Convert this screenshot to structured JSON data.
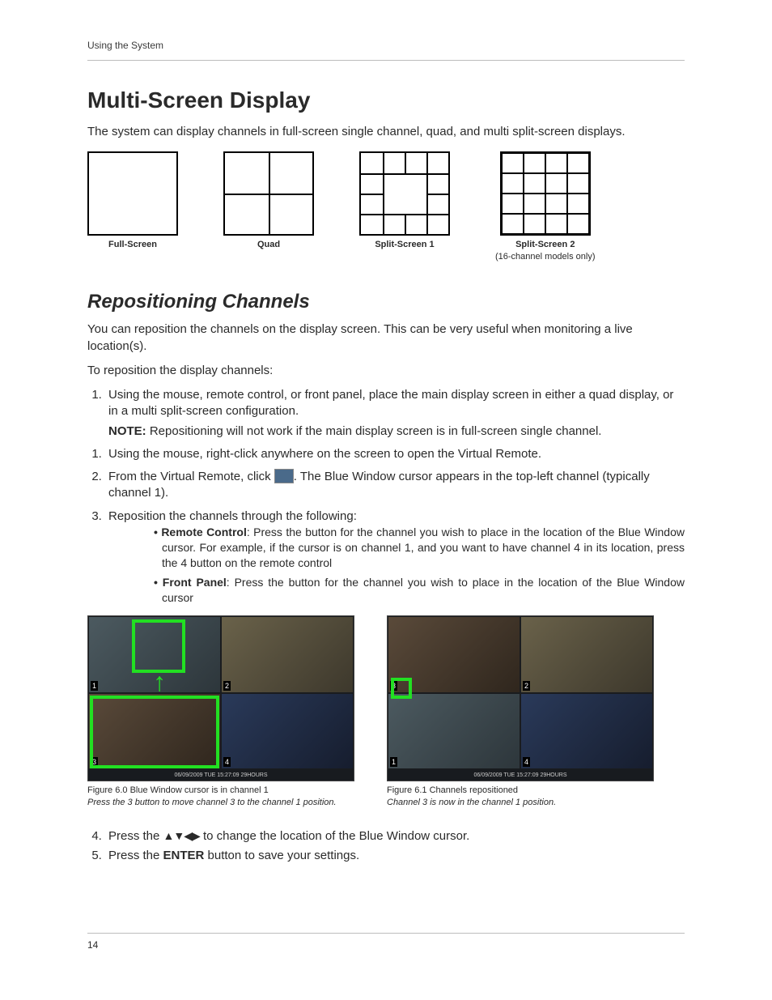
{
  "header": {
    "running": "Using the System"
  },
  "h1": "Multi-Screen Display",
  "intro": "The system can display channels in full-screen single channel, quad, and multi split-screen displays.",
  "modes": {
    "full": "Full-Screen",
    "quad": "Quad",
    "s1": "Split-Screen 1",
    "s2": "Split-Screen 2",
    "s2sub": "(16-channel models only)"
  },
  "h2": "Repositioning Channels",
  "p1": "You can reposition the channels on the display screen. This can be very useful when monitoring a live location(s).",
  "p2": "To reposition the display channels:",
  "step1a": "Using the mouse, remote control, or front panel, place the main display screen in either a quad display, or in a multi split-screen configuration.",
  "noteLabel": "NOTE:",
  "noteText": " Repositioning will not work if the main display screen is in full-screen single channel.",
  "step1b": "Using the mouse, right-click anywhere on the screen to open the Virtual Remote.",
  "step2a": "From the Virtual Remote, click ",
  "step2b": ". The Blue Window cursor appears in the top-left channel (typically channel 1).",
  "step3": "Reposition the channels through the following:",
  "bulletRCLabel": "Remote Control",
  "bulletRC": ": Press the button for the channel you wish to place in the location of the Blue Window cursor. For example, if the cursor is on channel 1, and you want to have channel 4 in its location, press the 4 button on the remote control",
  "bulletFPLabel": "Front Panel",
  "bulletFP": ": Press the button for the channel you wish to place in the location of the Blue Window cursor",
  "fig60": {
    "status": "06/09/2009   TUE  15:27:09    29HOURS",
    "cap": "Figure 6.0 Blue Window cursor is in channel 1",
    "sub": "Press the 3 button to move channel 3 to the channel 1 position."
  },
  "fig61": {
    "status": "06/09/2009   TUE  15:27:09    29HOURS",
    "cap": "Figure 6.1 Channels repositioned",
    "sub": "Channel 3 is now in the channel 1 position."
  },
  "step4a": "Press the ",
  "step4b": " to change the location of the Blue Window cursor.",
  "arrowsGlyph": "▲▼◀▶",
  "step5a": "Press the ",
  "step5bold": "ENTER",
  "step5b": " button to save your settings.",
  "pageNum": "14",
  "ch": {
    "c1": "1",
    "c2": "2",
    "c3": "3",
    "c4": "4"
  }
}
